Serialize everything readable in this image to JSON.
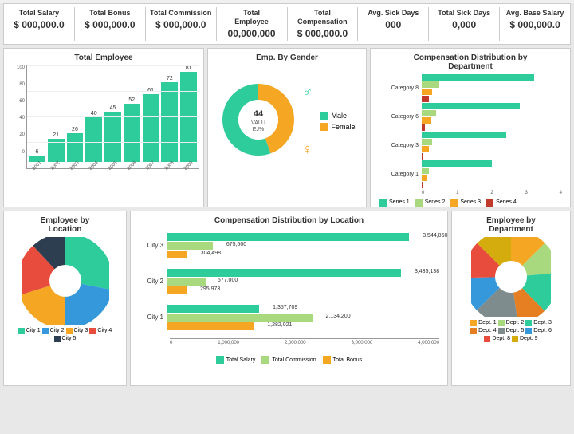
{
  "kpis": [
    {
      "label": "Total Salary",
      "value": "$ 000,000.0"
    },
    {
      "label": "Total Bonus",
      "value": "$ 000,000.0"
    },
    {
      "label": "Total Commission",
      "value": "$ 000,000.0"
    },
    {
      "label": "Total\nEmployee",
      "value": "00,000,000"
    },
    {
      "label": "Total\nCompensation",
      "value": "$ 000,000.0"
    },
    {
      "label": "Avg. Sick Days",
      "value": "000"
    },
    {
      "label": "Total Sick Days",
      "value": "0,000"
    },
    {
      "label": "Avg. Base Salary",
      "value": "$ 000,000.0"
    }
  ],
  "total_employee_chart": {
    "title": "Total Employee",
    "bars": [
      {
        "year": "2001",
        "value": 6,
        "height_pct": 7
      },
      {
        "year": "2002",
        "value": 21,
        "height_pct": 26
      },
      {
        "year": "2003",
        "value": 26,
        "height_pct": 32
      },
      {
        "year": "2004",
        "value": 40,
        "height_pct": 49
      },
      {
        "year": "2005",
        "value": 45,
        "height_pct": 56
      },
      {
        "year": "2006",
        "value": 52,
        "height_pct": 64
      },
      {
        "year": "2007",
        "value": 61,
        "height_pct": 75
      },
      {
        "year": "2008",
        "value": 72,
        "height_pct": 89
      },
      {
        "year": "2009",
        "value": 81,
        "height_pct": 100
      }
    ],
    "y_labels": [
      "0",
      "20",
      "40",
      "60",
      "80",
      "100"
    ]
  },
  "gender_chart": {
    "title": "Emp. By Gender",
    "male_pct": 56,
    "female_pct": 44,
    "center_label": "44",
    "sub_label": "VALU\nEJ%",
    "legend": [
      {
        "label": "Male",
        "color": "#2ecc9b"
      },
      {
        "label": "Female",
        "color": "#f5a623"
      }
    ]
  },
  "comp_dept_chart": {
    "title": "Compensation Distribution by\nDepartment",
    "categories": [
      "Category 8",
      "Category 6",
      "Category 3",
      "Category 1"
    ],
    "series": [
      {
        "name": "Series 1",
        "color": "#2ecc9b",
        "values": [
          3.2,
          2.8,
          2.4,
          2.0
        ]
      },
      {
        "name": "Series 2",
        "color": "#a8d97f",
        "values": [
          0.5,
          0.4,
          0.3,
          0.2
        ]
      },
      {
        "name": "Series 3",
        "color": "#f5a623",
        "values": [
          0.3,
          0.25,
          0.2,
          0.15
        ]
      },
      {
        "name": "Series 4",
        "color": "#c0392b",
        "values": [
          0.2,
          0.1,
          0.05,
          0.02
        ]
      }
    ],
    "x_labels": [
      "0",
      "1",
      "2",
      "3",
      "4"
    ]
  },
  "emp_by_location": {
    "title": "Employee by\nLocation",
    "slices": [
      {
        "label": "City 1",
        "color": "#2ecc9b",
        "pct": 28
      },
      {
        "label": "City 2",
        "color": "#3498db",
        "pct": 22
      },
      {
        "label": "City 3",
        "color": "#f5a623",
        "pct": 20
      },
      {
        "label": "City 4",
        "color": "#e74c3c",
        "pct": 18
      },
      {
        "label": "City 5",
        "color": "#2c3e50",
        "pct": 12
      }
    ]
  },
  "comp_by_location": {
    "title": "Compensation Distribution by Location",
    "cities": [
      "City 3",
      "City 2",
      "City 1"
    ],
    "bars": [
      {
        "city": "City 3",
        "salary": {
          "value": 3544860,
          "label": "3,544,860",
          "width_pct": 89
        },
        "commission": {
          "value": 675500,
          "label": "675,500",
          "width_pct": 17
        },
        "bonus": {
          "value": 304498,
          "label": "304,498",
          "width_pct": 7.6
        }
      },
      {
        "city": "City 2",
        "salary": {
          "value": 3435138,
          "label": "3,435,138",
          "width_pct": 86
        },
        "commission": {
          "value": 577000,
          "label": "577,000",
          "width_pct": 14.4
        },
        "bonus": {
          "value": 295973,
          "label": "295,973",
          "width_pct": 7.4
        }
      },
      {
        "city": "City 1",
        "salary": {
          "value": 1357709,
          "label": "1,357,709",
          "width_pct": 34
        },
        "commission": {
          "value": 2134200,
          "label": "2,134,200",
          "width_pct": 53.4
        },
        "bonus": {
          "value": 1282021,
          "label": "1,282,021",
          "width_pct": 32
        }
      }
    ],
    "legend": [
      {
        "label": "Total Salary",
        "color": "#2ecc9b"
      },
      {
        "label": "Total Commission",
        "color": "#a8d97f"
      },
      {
        "label": "Total Bonus",
        "color": "#f5a623"
      }
    ],
    "x_labels": [
      "0",
      "1,000,000",
      "2,000,000",
      "3,000,000",
      "4,000,000"
    ]
  },
  "emp_by_dept": {
    "title": "Employee by\nDepartment",
    "slices": [
      {
        "label": "Dept. 1",
        "color": "#f5a623"
      },
      {
        "label": "Dept. 2",
        "color": "#a8d97f"
      },
      {
        "label": "Dept. 3",
        "color": "#2ecc9b"
      },
      {
        "label": "Dept. 4",
        "color": "#e67e22"
      },
      {
        "label": "Dept. 5",
        "color": "#7f8c8d"
      },
      {
        "label": "Dept. 6",
        "color": "#3498db"
      },
      {
        "label": "Dept. 8",
        "color": "#e74c3c"
      },
      {
        "label": "Dept. 9",
        "color": "#d4ac0d"
      }
    ]
  }
}
